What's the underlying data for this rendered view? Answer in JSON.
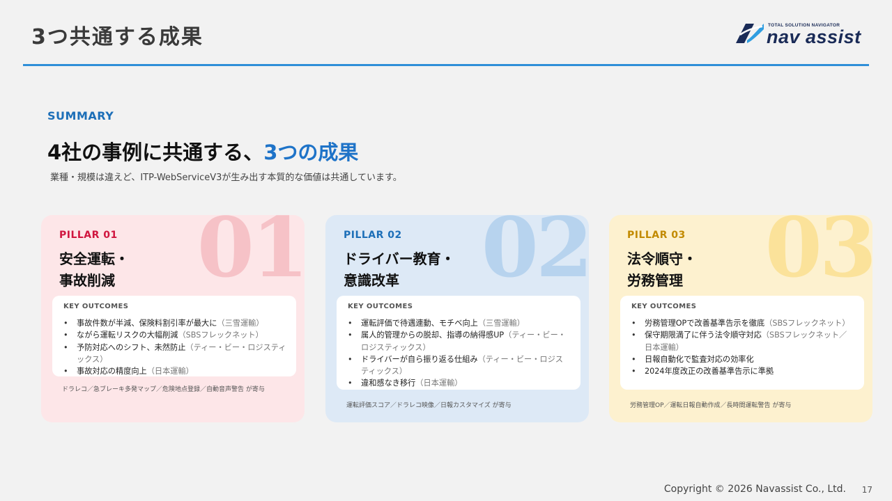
{
  "header": {
    "title": "3つ共通する成果"
  },
  "logo": {
    "tagline": "TOTAL SOLUTION NAVIGATOR",
    "wordmark": "nav assist"
  },
  "summary": {
    "eyebrow": "SUMMARY",
    "headline_main": "4社の事例に共通する、",
    "headline_accent": "3つの成果",
    "subtext": "業種・規模は違えど、ITP-WebServiceV3が生み出す本質的な価値は共通しています。"
  },
  "pillars": [
    {
      "label": "PILLAR 01",
      "number": "01",
      "title_lines": [
        "安全運転・",
        "事故削減"
      ],
      "outcomes_label": "KEY OUTCOMES",
      "items": [
        {
          "text": "事故件数が半減、保険料割引率が最大に",
          "note": "（三雪運輸）"
        },
        {
          "text": "ながら運転リスクの大幅削減",
          "note": "（SBSフレックネット）"
        },
        {
          "text": "予防対応へのシフト、未然防止",
          "note": "（ティー・ビー・ロジスティックス）"
        },
        {
          "text": "事故対応の精度向上",
          "note": "（日本運輸）"
        }
      ],
      "contrib": "ドラレコ／急ブレーキ多発マップ／危険地点登録／自動音声警告 が寄与"
    },
    {
      "label": "PILLAR 02",
      "number": "02",
      "title_lines": [
        "ドライバー教育・",
        "意識改革"
      ],
      "outcomes_label": "KEY OUTCOMES",
      "items": [
        {
          "text": "運転評価で待遇連動、モチベ向上",
          "note": "（三雪運輸）"
        },
        {
          "text": "属人的管理からの脱却、指導の納得感UP",
          "note": "（ティー・ビー・ロジスティックス）"
        },
        {
          "text": "ドライバーが自ら振り返る仕組み",
          "note": "（ティー・ビー・ロジスティックス）"
        },
        {
          "text": "違和感なき移行",
          "note": "（日本運輸）"
        }
      ],
      "contrib": "運転評価スコア／ドラレコ映像／日報カスタマイズ が寄与"
    },
    {
      "label": "PILLAR 03",
      "number": "03",
      "title_lines": [
        "法令順守・",
        "労務管理"
      ],
      "outcomes_label": "KEY OUTCOMES",
      "items": [
        {
          "text": "労務管理OPで改善基準告示を徹底",
          "note": "（SBSフレックネット）"
        },
        {
          "text": "保守期限満了に伴う法令順守対応",
          "note": "（SBSフレックネット／日本運輸）"
        },
        {
          "text": "日報自動化で監査対応の効率化",
          "note": ""
        },
        {
          "text": "2024年度改正の改善基準告示に準拠",
          "note": ""
        }
      ],
      "contrib": "労務管理OP／運転日報自動作成／長時間運転警告 が寄与"
    }
  ],
  "footer": {
    "copyright": "Copyright © 2026 Navassist Co., Ltd.",
    "page": "17"
  },
  "colors": {
    "accent_blue": "#1e73c8",
    "rule_blue": "#2f8fd8",
    "pillar1": "#d0163f",
    "pillar2": "#1d6fb8",
    "pillar3": "#c28a00"
  }
}
